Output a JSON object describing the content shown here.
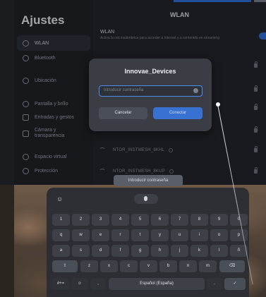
{
  "settings": {
    "title": "Ajustes",
    "sidebar": [
      {
        "label": "WLAN",
        "icon": "wifi-icon",
        "active": true
      },
      {
        "label": "Bluetooth",
        "icon": "bluetooth-icon",
        "active": false
      },
      {
        "label": "Ubicación",
        "icon": "location-icon",
        "active": false
      },
      {
        "label": "Pantalla y brillo",
        "icon": "brightness-icon",
        "active": false
      },
      {
        "label": "Entradas y gestos",
        "icon": "gesture-icon",
        "active": false
      },
      {
        "label": "Cámara y transparencia",
        "icon": "camera-icon",
        "active": false
      },
      {
        "label": "Espacio virtual",
        "icon": "space-icon",
        "active": false
      },
      {
        "label": "Protección",
        "icon": "shield-icon",
        "active": false
      }
    ]
  },
  "wlan": {
    "header": "WLAN",
    "row_title": "WLAN",
    "row_desc": "Activa la red inalámbrica para acceder a Internet y a contenido en streaming",
    "networks": [
      {
        "name": "NTOR_INSTMESH_8KHL"
      },
      {
        "name": "NTOR_INSTMESH_8KUP"
      }
    ]
  },
  "dialog": {
    "title": "Innovae_Devices",
    "password_placeholder": "Introducir contraseña",
    "cancel_label": "Cancelar",
    "connect_label": "Conectar"
  },
  "input_preview": "Introducir contraseña",
  "keyboard": {
    "emoji_label": "☺",
    "row1": [
      "1",
      "2",
      "3",
      "4",
      "5",
      "6",
      "7",
      "8",
      "9",
      "0"
    ],
    "row2": [
      "q",
      "w",
      "e",
      "r",
      "t",
      "y",
      "u",
      "i",
      "o",
      "p"
    ],
    "row3": [
      "a",
      "s",
      "d",
      "f",
      "g",
      "h",
      "j",
      "k",
      "l",
      "ñ"
    ],
    "row4": [
      "z",
      "x",
      "c",
      "v",
      "b",
      "n",
      "m"
    ],
    "shift_label": "⇧",
    "backspace_label": "⌫",
    "symbols_label": "#+=",
    "emoji2_label": "☺",
    "comma_label": ",",
    "space_label": "Español (España)",
    "period_label": ".",
    "enter_label": "✓"
  },
  "colors": {
    "accent": "#3871d1",
    "focus_border": "#4d8ef5",
    "panel": "#22252b"
  }
}
